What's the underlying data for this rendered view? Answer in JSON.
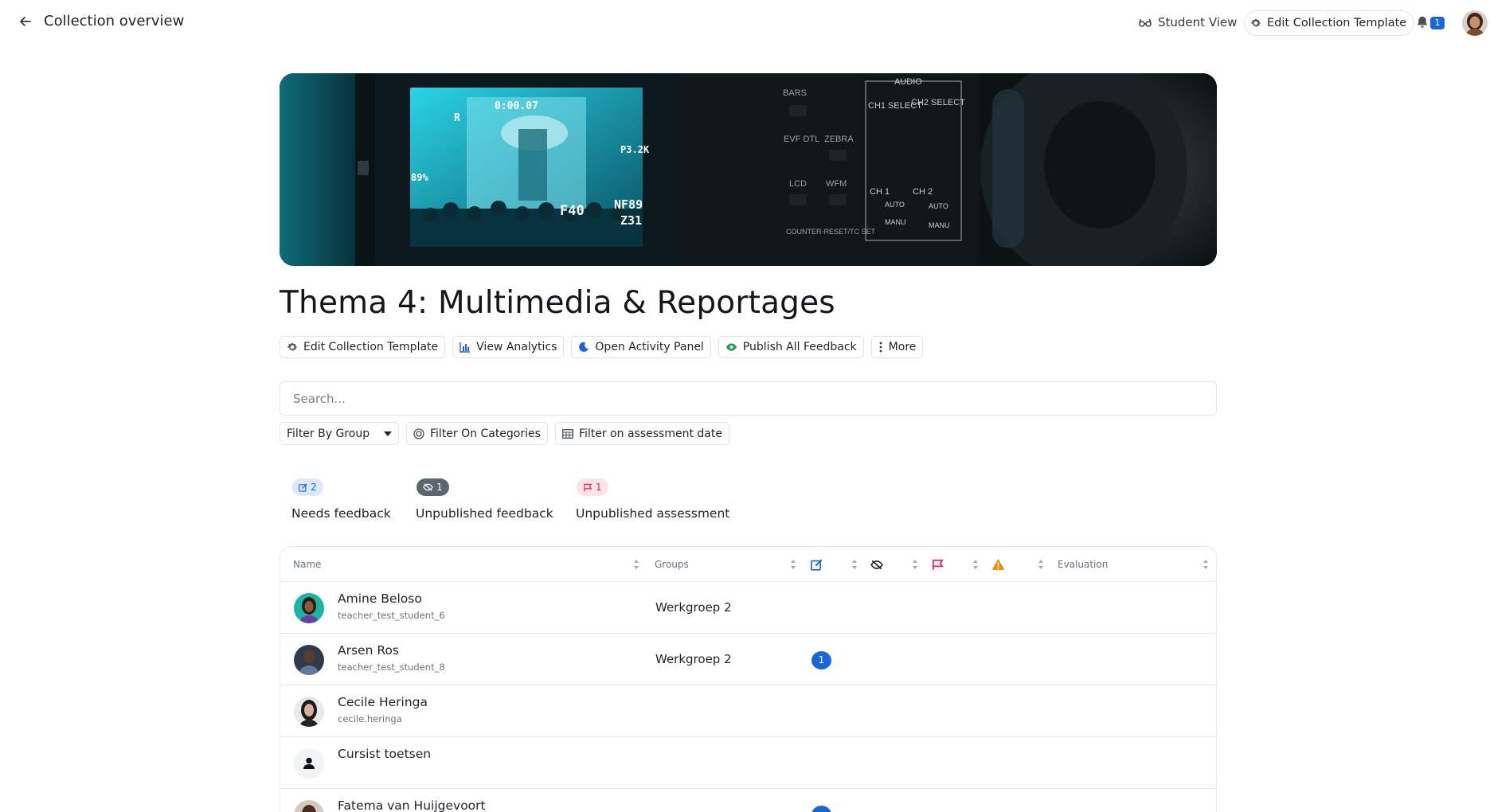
{
  "header": {
    "title": "Collection overview",
    "student_view": "Student View",
    "edit_template": "Edit Collection Template",
    "notification_count": "1"
  },
  "collection": {
    "title": "Thema 4: Multimedia & Reportages",
    "banner_texts": {
      "audio": "AUDIO",
      "bars": "BARS",
      "ch1_select": "CH1 SELECT",
      "ch2_select": "CH2 SELECT",
      "zebra": "ZEBRA",
      "wfm": "WFM",
      "lcd": "LCD",
      "evf": "EVF DTL",
      "ch1": "CH 1",
      "ch2": "CH 2",
      "auto": "AUTO",
      "manu": "MANU",
      "f40": "F40",
      "nf89": "NF89",
      "z31": "Z31",
      "p3": "P3.2K",
      "pct": "89%",
      "counter": "COUNTER-RESET/TC SET"
    }
  },
  "actions": {
    "edit_template": "Edit Collection Template",
    "view_analytics": "View Analytics",
    "open_activity": "Open Activity Panel",
    "publish_feedback": "Publish All Feedback",
    "more": "More"
  },
  "search": {
    "placeholder": "Search..."
  },
  "filters": {
    "group": "Filter By Group",
    "categories": "Filter On Categories",
    "assessment_date": "Filter on assessment date"
  },
  "stats": [
    {
      "count": "2",
      "label": "Needs feedback",
      "color": "#1a66d8",
      "bg": "#dce9fb"
    },
    {
      "count": "1",
      "label": "Unpublished feedback",
      "color": "#ffffff",
      "bg": "#5c6670"
    },
    {
      "count": "1",
      "label": "Unpublished assessment",
      "color": "#e0245e",
      "bg": "#fde2e8"
    }
  ],
  "table": {
    "columns": {
      "name": "Name",
      "groups": "Groups",
      "evaluation": "Evaluation"
    },
    "rows": [
      {
        "name": "Amine Beloso",
        "username": "teacher_test_student_6",
        "group": "Werkgroep 2",
        "feedback": ""
      },
      {
        "name": "Arsen Ros",
        "username": "teacher_test_student_8",
        "group": "Werkgroep 2",
        "feedback": "1"
      },
      {
        "name": "Cecile Heringa",
        "username": "cecile.heringa",
        "group": "",
        "feedback": ""
      },
      {
        "name": "Cursist toetsen",
        "username": "",
        "group": "",
        "feedback": ""
      },
      {
        "name": "Fatema van Huijgevoort",
        "username": "",
        "group": "",
        "feedback": ""
      }
    ]
  },
  "colors": {
    "accent": "#1a66d8",
    "warning": "#f08c00",
    "flag": "#e0245e"
  }
}
